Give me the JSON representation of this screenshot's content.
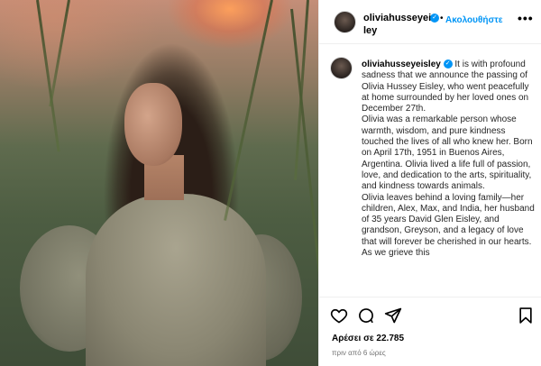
{
  "header": {
    "username": "oliviahusseyeisley",
    "verified_mark": "✓",
    "separator": "•",
    "follow_label": "Ακολουθήστε",
    "more_label": "•••"
  },
  "caption": {
    "username": "oliviahusseyeisley",
    "verified_mark": "✓",
    "paragraphs": [
      "It is with profound sadness that we announce the passing of Olivia Hussey Eisley, who went peacefully at home surrounded by her loved ones on December 27th.",
      "Olivia was a remarkable person whose warmth, wisdom, and pure kindness touched the lives of all who knew her. Born on April 17th, 1951 in Buenos Aires, Argentina. Olivia lived a life full of passion, love, and dedication to the arts, spirituality, and kindness towards animals.",
      "Olivia leaves behind a loving family—her children, Alex, Max, and India, her husband of 35 years David Glen Eisley, and grandson, Greyson, and a legacy of love that will forever be cherished in our hearts. As we grieve this"
    ]
  },
  "actions": {
    "icons": [
      "heart-icon",
      "comment-icon",
      "share-icon",
      "bookmark-icon"
    ],
    "likes_label": "Αρέσει σε 22.785",
    "time_label": "πριν από 6 ώρες"
  },
  "colors": {
    "accent": "#0095f6",
    "text": "#262626",
    "muted": "#737373",
    "border": "#efefef"
  }
}
